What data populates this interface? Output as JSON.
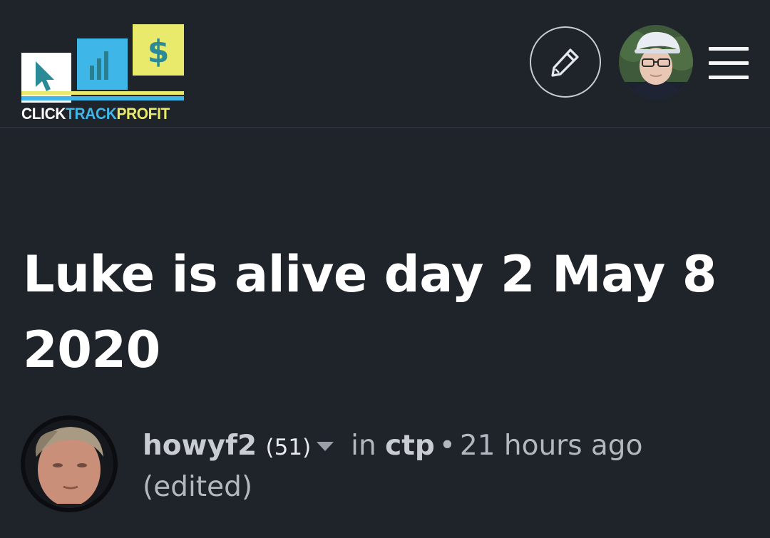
{
  "logo": {
    "word_click": "CLICK",
    "word_track": "TRACK",
    "word_profit": "PROFIT",
    "dollar_sign": "$",
    "colors": {
      "white": "#ffffff",
      "blue": "#3fb6e8",
      "yellow": "#e9ea6b",
      "teal": "#2a8a96"
    }
  },
  "header": {
    "write_icon": "pencil-icon",
    "menu_icon": "hamburger-menu-icon",
    "user_avatar": "user-avatar"
  },
  "post": {
    "title": "Luke is alive day 2 May 8 2020",
    "author": "howyf2",
    "reputation": "(51)",
    "in_label": "in",
    "community": "ctp",
    "separator": "•",
    "time": "21 hours ago",
    "edited": "(edited)"
  },
  "theme": {
    "background": "#1f232a",
    "text_primary": "#ffffff",
    "text_secondary": "#b3b8bf"
  }
}
